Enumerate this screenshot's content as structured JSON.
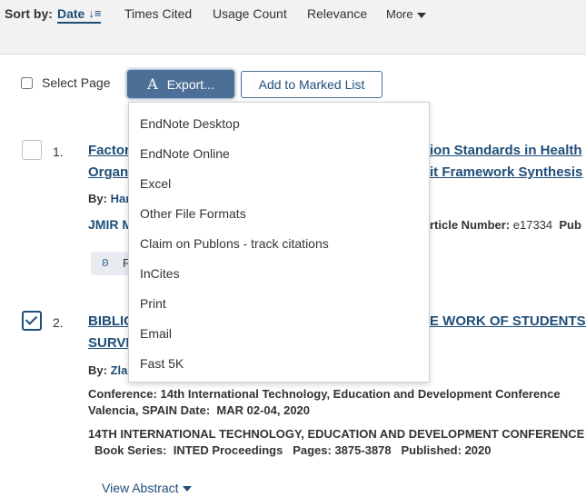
{
  "sort": {
    "label": "Sort by:",
    "date": "Date",
    "times_cited": "Times Cited",
    "usage_count": "Usage Count",
    "relevance": "Relevance",
    "more": "More"
  },
  "toolbar": {
    "select_page": "Select Page",
    "export_icon": "A",
    "export_label": "Export...",
    "add_marked": "Add to Marked List"
  },
  "export_menu": [
    "EndNote Desktop",
    "EndNote Online",
    "Excel",
    "Other File Formats",
    "Claim on Publons - track citations",
    "InCites",
    "Print",
    "Email",
    "Fast 5K"
  ],
  "records": [
    {
      "num": "1.",
      "checked": false,
      "title_l1_left": "Factor",
      "title_l1_right": "ion Standards in Health",
      "title_l2_left": "Organ",
      "title_l2_right": "it Framework Synthesis",
      "by_label": "By:",
      "by_name": "Har",
      "source_left": "JMIR M",
      "article_label": "rticle Number:",
      "article_value": "e17334",
      "pub_cut": "Pub",
      "badge_text": "F"
    },
    {
      "num": "2.",
      "checked": true,
      "title_l1_left": "BIBLIC",
      "title_l1_right": "E WORK OF STUDENTS I",
      "title_l2_left": "SURVE",
      "by_label": "By:",
      "by_name": "Zla",
      "conf_label": "Conference:",
      "conf_value": "14th International Technology, Education and Development Conference",
      "conf_loc": "Valencia, SPAIN",
      "date_label": "Date:",
      "date_value": "MAR 02-04, 2020",
      "proceedings": "14TH INTERNATIONAL TECHNOLOGY, EDUCATION AND DEVELOPMENT CONFERENCE",
      "series_label": "Book Series:",
      "series_value": "INTED Proceedings",
      "pages_label": "Pages:",
      "pages_value": "3875-3878",
      "published_label": "Published:",
      "published_value": "2020",
      "view_abstract": "View Abstract"
    }
  ],
  "colors": {
    "accent": "#1f4e79",
    "export_bg": "#4d6f97"
  }
}
